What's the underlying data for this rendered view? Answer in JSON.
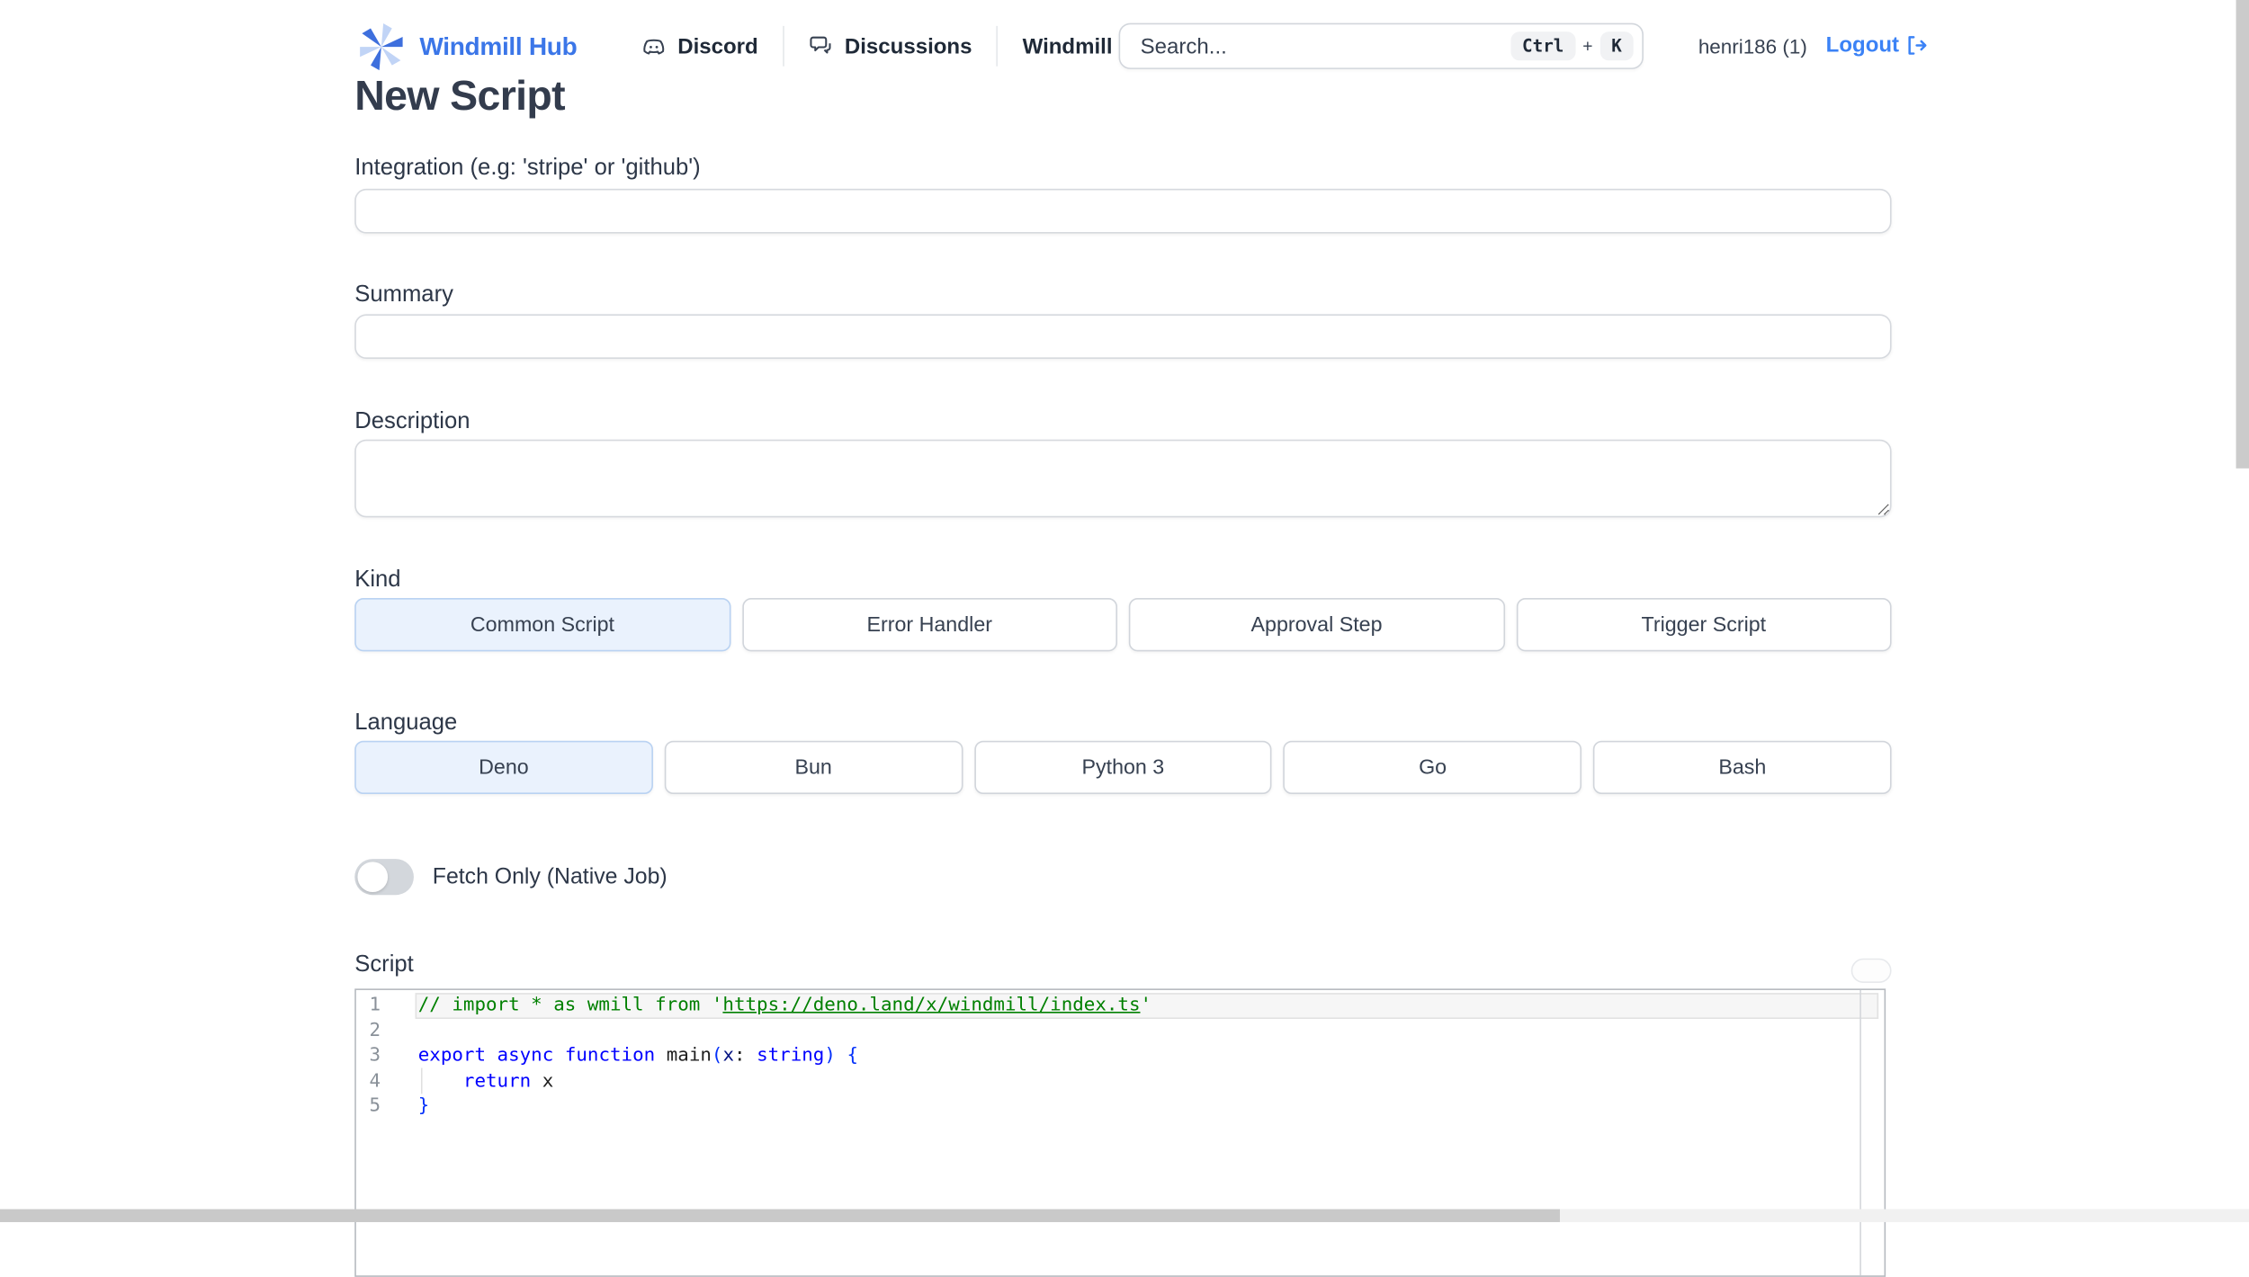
{
  "header": {
    "logo_text": "Windmill Hub",
    "nav": [
      {
        "label": "Discord"
      },
      {
        "label": "Discussions"
      },
      {
        "label": "Windmill"
      }
    ],
    "search": {
      "placeholder": "Search...",
      "value": "",
      "shortcut_keys": [
        "Ctrl",
        "K"
      ],
      "shortcut_separator": "+"
    },
    "user": "henri186 (1)",
    "logout_label": "Logout"
  },
  "main": {
    "title": "New Script",
    "fields": {
      "integration_label": "Integration (e.g: 'stripe' or 'github')",
      "integration_value": "",
      "summary_label": "Summary",
      "summary_value": "",
      "description_label": "Description",
      "description_value": ""
    },
    "kind": {
      "label": "Kind",
      "options": [
        {
          "label": "Common Script",
          "selected": true
        },
        {
          "label": "Error Handler",
          "selected": false
        },
        {
          "label": "Approval Step",
          "selected": false
        },
        {
          "label": "Trigger Script",
          "selected": false
        }
      ]
    },
    "language": {
      "label": "Language",
      "options": [
        {
          "label": "Deno",
          "selected": true
        },
        {
          "label": "Bun",
          "selected": false
        },
        {
          "label": "Python 3",
          "selected": false
        },
        {
          "label": "Go",
          "selected": false
        },
        {
          "label": "Bash",
          "selected": false
        }
      ]
    },
    "fetch_only": {
      "label": "Fetch Only (Native Job)",
      "enabled": false
    },
    "script_label": "Script"
  },
  "editor": {
    "language": "deno",
    "lines": [
      {
        "num": 1,
        "current": true,
        "tokens": [
          {
            "t": "// import * as wmill from '",
            "c": "comment"
          },
          {
            "t": "https://deno.land/x/windmill/index.ts",
            "c": "comment link"
          },
          {
            "t": "'",
            "c": "comment"
          }
        ]
      },
      {
        "num": 2,
        "current": false,
        "tokens": []
      },
      {
        "num": 3,
        "current": false,
        "tokens": [
          {
            "t": "export",
            "c": "kw"
          },
          {
            "t": " ",
            "c": "plain"
          },
          {
            "t": "async",
            "c": "kw"
          },
          {
            "t": " ",
            "c": "plain"
          },
          {
            "t": "function",
            "c": "kw"
          },
          {
            "t": " main",
            "c": "plain"
          },
          {
            "t": "(",
            "c": "bracket"
          },
          {
            "t": "x",
            "c": "param"
          },
          {
            "t": ": ",
            "c": "plain"
          },
          {
            "t": "string",
            "c": "kw"
          },
          {
            "t": ")",
            "c": "bracket"
          },
          {
            "t": " {",
            "c": "bracket"
          }
        ]
      },
      {
        "num": 4,
        "current": false,
        "tokens": [
          {
            "t": "    ",
            "c": "plain"
          },
          {
            "t": "return",
            "c": "kw"
          },
          {
            "t": " x",
            "c": "plain"
          }
        ]
      },
      {
        "num": 5,
        "current": false,
        "tokens": [
          {
            "t": "}",
            "c": "bracket"
          }
        ]
      }
    ],
    "colors": {
      "comment": "#008000",
      "keyword": "#0000ff",
      "bracket": "#0431fa",
      "plain": "#1f1f1f",
      "param": "#001080"
    }
  },
  "colors": {
    "accent": "#3b82f6",
    "logo_blue": "#3b76e8",
    "selected_bg": "#eaf2fd",
    "selected_border": "#b9d2f2"
  }
}
